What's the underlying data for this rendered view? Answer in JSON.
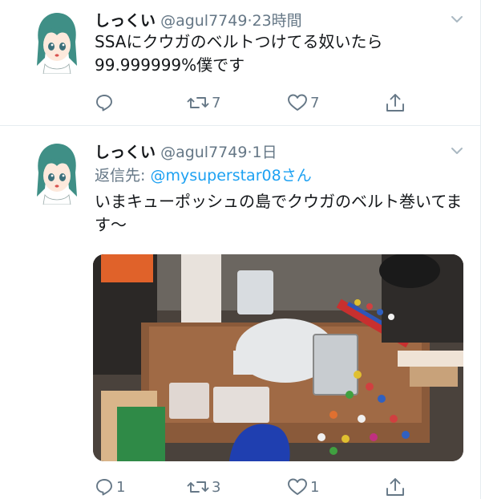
{
  "tweets": [
    {
      "name": "しっくい",
      "handle": "@agul7749",
      "dot": "·",
      "time": "23時間",
      "text": "SSAにクウガのベルトつけてる奴いたら99.999999%僕です",
      "actions": {
        "reply": "",
        "retweet": "7",
        "like": "7"
      }
    },
    {
      "name": "しっくい",
      "handle": "@agul7749",
      "dot": "·",
      "time": "1日",
      "reply_label": "返信先: ",
      "reply_mention": "@mysuperstar08さん",
      "text": "いまキューポッシュの島でクウガのベルト巻いてます〜",
      "actions": {
        "reply": "1",
        "retweet": "3",
        "like": "1"
      }
    }
  ],
  "icons": {
    "avatar": "anime-girl-avatar",
    "menu": "chevron-down-icon",
    "reply": "reply-icon",
    "retweet": "retweet-icon",
    "like": "heart-icon",
    "share": "share-icon"
  },
  "colors": {
    "text": "#14171a",
    "secondary": "#657786",
    "link": "#1da1f2",
    "divider": "#e6ecf0"
  }
}
